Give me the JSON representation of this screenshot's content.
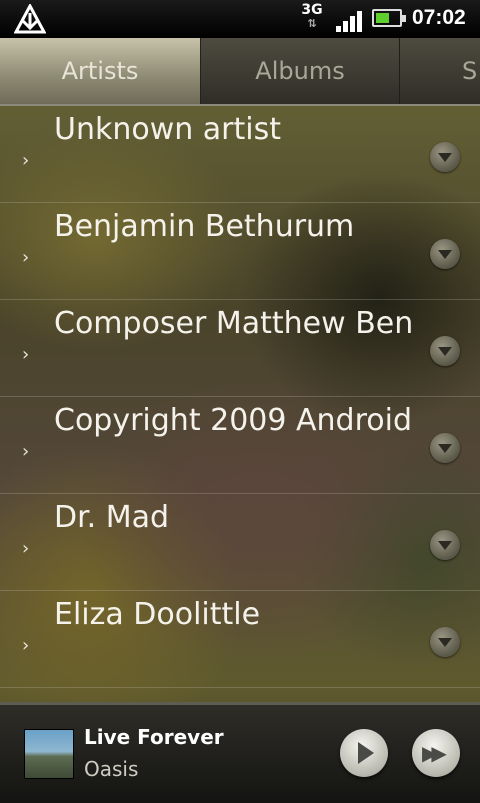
{
  "status_bar": {
    "network": "3G",
    "network_arrows": "⇅",
    "time": "07:02",
    "battery_level": 0.6,
    "signal_level": 4
  },
  "tabs": [
    {
      "label": "Artists",
      "active": true
    },
    {
      "label": "Albums",
      "active": false
    },
    {
      "label": "S",
      "active": false
    }
  ],
  "artists": [
    "Unknown artist",
    "Benjamin Bethurum",
    "Composer Matthew Ben",
    "Copyright 2009 Android",
    "Dr. Mad",
    "Eliza Doolittle"
  ],
  "now_playing": {
    "title": "Live Forever",
    "artist": "Oasis"
  },
  "colors": {
    "battery": "#5fce2f",
    "text": "#f4f2ea"
  }
}
